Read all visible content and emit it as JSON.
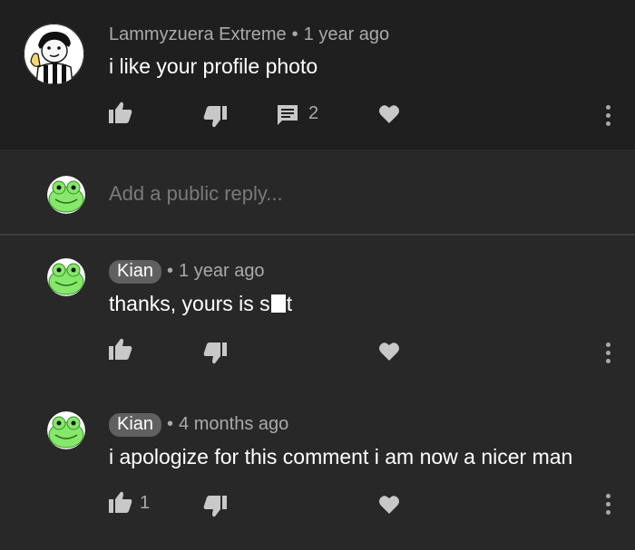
{
  "comment": {
    "author": "Lammyzuera Extreme",
    "separator": "•",
    "time": "1 year ago",
    "text": "i like your profile photo",
    "reply_count": "2"
  },
  "reply_input": {
    "placeholder": "Add a public reply..."
  },
  "replies": [
    {
      "author": "Kian",
      "separator": "•",
      "time": "1 year ago",
      "text_before": "thanks, yours is s",
      "text_after": "t"
    },
    {
      "author": "Kian",
      "separator": "•",
      "time": "4 months ago",
      "text": "i apologize for this comment i am now a nicer man",
      "like_count": "1"
    }
  ],
  "colors": {
    "background": "#282828",
    "comment_background": "#1f1f1f",
    "text": "#ffffff",
    "secondary_text": "#aaaaaa",
    "badge": "#606060"
  }
}
